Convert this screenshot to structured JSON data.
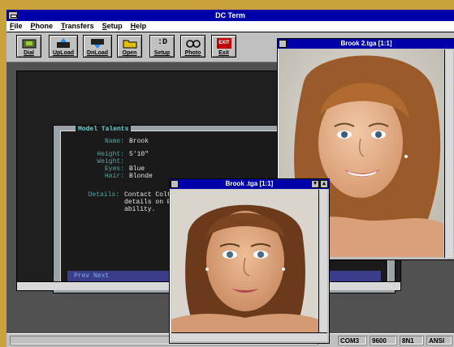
{
  "app": {
    "title": "DC Term"
  },
  "menu": [
    "File",
    "Phone",
    "Transfers",
    "Setup",
    "Help"
  ],
  "toolbar": [
    {
      "label": "Dial",
      "icon": "dial-icon"
    },
    {
      "label": "UpLoad",
      "icon": "upload-icon"
    },
    {
      "label": "DnLoad",
      "icon": "download-icon"
    },
    {
      "label": "Open",
      "icon": "folder-icon"
    },
    {
      "label": "Setup",
      "icon": "setup-icon",
      "glyph": ":D"
    },
    {
      "label": "Photo",
      "icon": "photo-icon"
    },
    {
      "label": "Exit",
      "icon": "exit-icon",
      "glyph": "EXIT"
    }
  ],
  "talents": {
    "title": "Model Talents",
    "name_label": "Name:",
    "name": "Brook",
    "height_label": "Height:",
    "height": "5'10\"",
    "weight_label": "Weight:",
    "weight": "",
    "eyes_label": "Eyes:",
    "eyes": "Blue",
    "hair_label": "Hair:",
    "hair": "Blonde",
    "details_label": "Details:",
    "details_1": "Contact Coltan",
    "details_2": "details on Brook",
    "details_3": "ability.",
    "nav": "Prev Next"
  },
  "photo1": {
    "title": "Brook 2.tga [1:1]"
  },
  "photo2": {
    "title": "Brook .tga [1:1]"
  },
  "status": {
    "port": "COM3",
    "baud": "9600",
    "format": "8N1",
    "emulation": "ANSI"
  },
  "colors": {
    "title_bar": "#0000a8",
    "window_bg": "#c0c0c0",
    "terminal_bg": "#1a1a1a"
  }
}
